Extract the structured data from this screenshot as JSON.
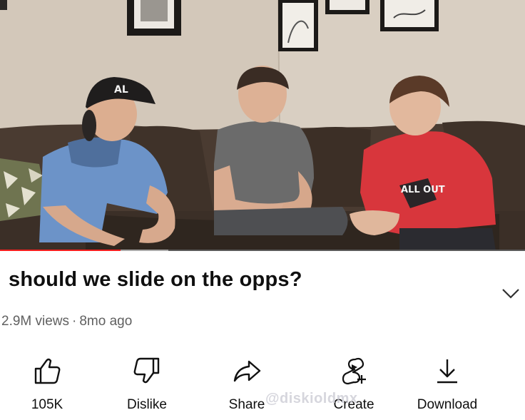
{
  "video": {
    "cap_text": "AL",
    "shirt_text": "ALL OUT",
    "progress_fraction": 0.23,
    "buffer_fraction": 0.32
  },
  "title": "should we slide on the opps?",
  "meta": {
    "views": "2.9M views",
    "separator": "·",
    "age": "8mo ago"
  },
  "actions": {
    "like_label": "105K",
    "dislike_label": "Dislike",
    "share_label": "Share",
    "create_label": "Create",
    "download_label": "Download"
  },
  "watermark": "@diskioldmx"
}
